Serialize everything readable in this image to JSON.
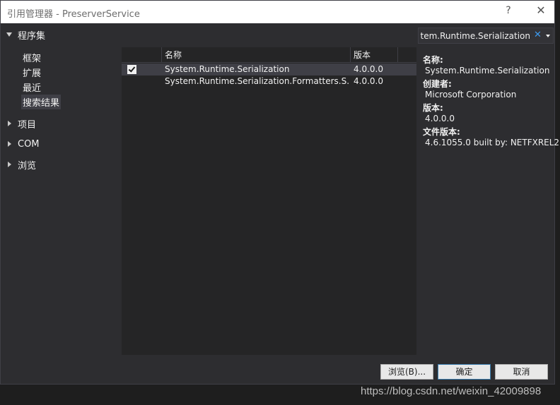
{
  "window": {
    "title": "引用管理器 - PreserverService",
    "help_label": "?",
    "close_label": "✕"
  },
  "nav": {
    "assemblies_label": "程序集",
    "assembly_items": [
      "框架",
      "扩展",
      "最近",
      "搜索结果"
    ],
    "selected_item": "搜索结果",
    "projects_label": "项目",
    "com_label": "COM",
    "browse_label": "浏览"
  },
  "list": {
    "columns": [
      "名称",
      "版本"
    ],
    "rows": [
      {
        "checked": true,
        "name": "System.Runtime.Serialization",
        "version": "4.0.0.0"
      },
      {
        "checked": false,
        "name": "System.Runtime.Serialization.Formatters.S...",
        "version": "4.0.0.0"
      }
    ]
  },
  "search": {
    "value": "System.Runtime.Serialization",
    "clear_icon": "close-icon",
    "dropdown_icon": "chevron-down-icon"
  },
  "details": {
    "name_key": "名称:",
    "name_value": "System.Runtime.Serialization",
    "creator_key": "创建者:",
    "creator_value": "Microsoft Corporation",
    "version_key": "版本:",
    "version_value": "4.0.0.0",
    "file_version_key": "文件版本:",
    "file_version_value": "4.6.1055.0 built by: NETFXREL2"
  },
  "footer": {
    "browse_button": "浏览(B)...",
    "ok_button": "确定",
    "cancel_button": "取消"
  },
  "watermark": "https://blog.csdn.net/weixin_42009898",
  "colors": {
    "background": "#2d2d30",
    "list_background": "#252526",
    "selection": "#3f3f46",
    "accent": "#3c9bf0"
  }
}
